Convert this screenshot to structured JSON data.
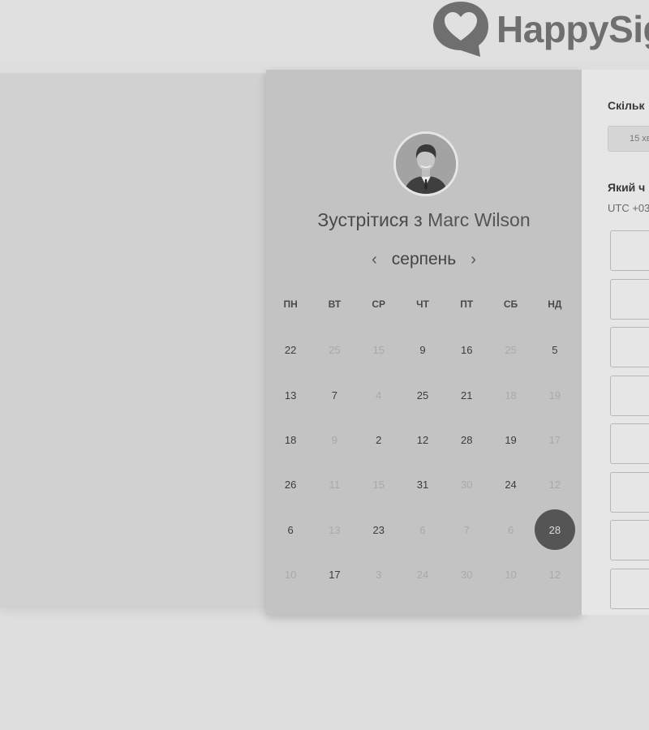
{
  "header": {
    "logo_text": "HappySig"
  },
  "scheduler": {
    "title_prefix": "Зустрітися з",
    "host_name": "Marc Wilson",
    "month": "серпень",
    "prev_arrow": "‹",
    "next_arrow": "›",
    "weekdays": [
      "ПН",
      "ВТ",
      "СР",
      "ЧТ",
      "ПТ",
      "СБ",
      "НД"
    ],
    "days": [
      {
        "n": "22",
        "a": true
      },
      {
        "n": "25",
        "a": false
      },
      {
        "n": "15",
        "a": false
      },
      {
        "n": "9",
        "a": true
      },
      {
        "n": "16",
        "a": true
      },
      {
        "n": "25",
        "a": false
      },
      {
        "n": "5",
        "a": true
      },
      {
        "n": "13",
        "a": true
      },
      {
        "n": "7",
        "a": true
      },
      {
        "n": "4",
        "a": false
      },
      {
        "n": "25",
        "a": true
      },
      {
        "n": "21",
        "a": true
      },
      {
        "n": "18",
        "a": false
      },
      {
        "n": "19",
        "a": false
      },
      {
        "n": "18",
        "a": true
      },
      {
        "n": "9",
        "a": false
      },
      {
        "n": "2",
        "a": true
      },
      {
        "n": "12",
        "a": true
      },
      {
        "n": "28",
        "a": true
      },
      {
        "n": "19",
        "a": true
      },
      {
        "n": "17",
        "a": false
      },
      {
        "n": "26",
        "a": true
      },
      {
        "n": "11",
        "a": false
      },
      {
        "n": "15",
        "a": false
      },
      {
        "n": "31",
        "a": true
      },
      {
        "n": "30",
        "a": false
      },
      {
        "n": "24",
        "a": true
      },
      {
        "n": "12",
        "a": false
      },
      {
        "n": "6",
        "a": true
      },
      {
        "n": "13",
        "a": false
      },
      {
        "n": "23",
        "a": true
      },
      {
        "n": "6",
        "a": false
      },
      {
        "n": "7",
        "a": false
      },
      {
        "n": "6",
        "a": false
      },
      {
        "n": "28",
        "a": true,
        "selected": true
      },
      {
        "n": "10",
        "a": false
      },
      {
        "n": "17",
        "a": true
      },
      {
        "n": "3",
        "a": false
      },
      {
        "n": "24",
        "a": false
      },
      {
        "n": "30",
        "a": false
      },
      {
        "n": "10",
        "a": false
      },
      {
        "n": "12",
        "a": false
      }
    ]
  },
  "details": {
    "duration_label": "Скільк",
    "duration_value": "15 хв",
    "time_label": "Який ч",
    "timezone": "UTC +03",
    "slot_count": 8
  }
}
